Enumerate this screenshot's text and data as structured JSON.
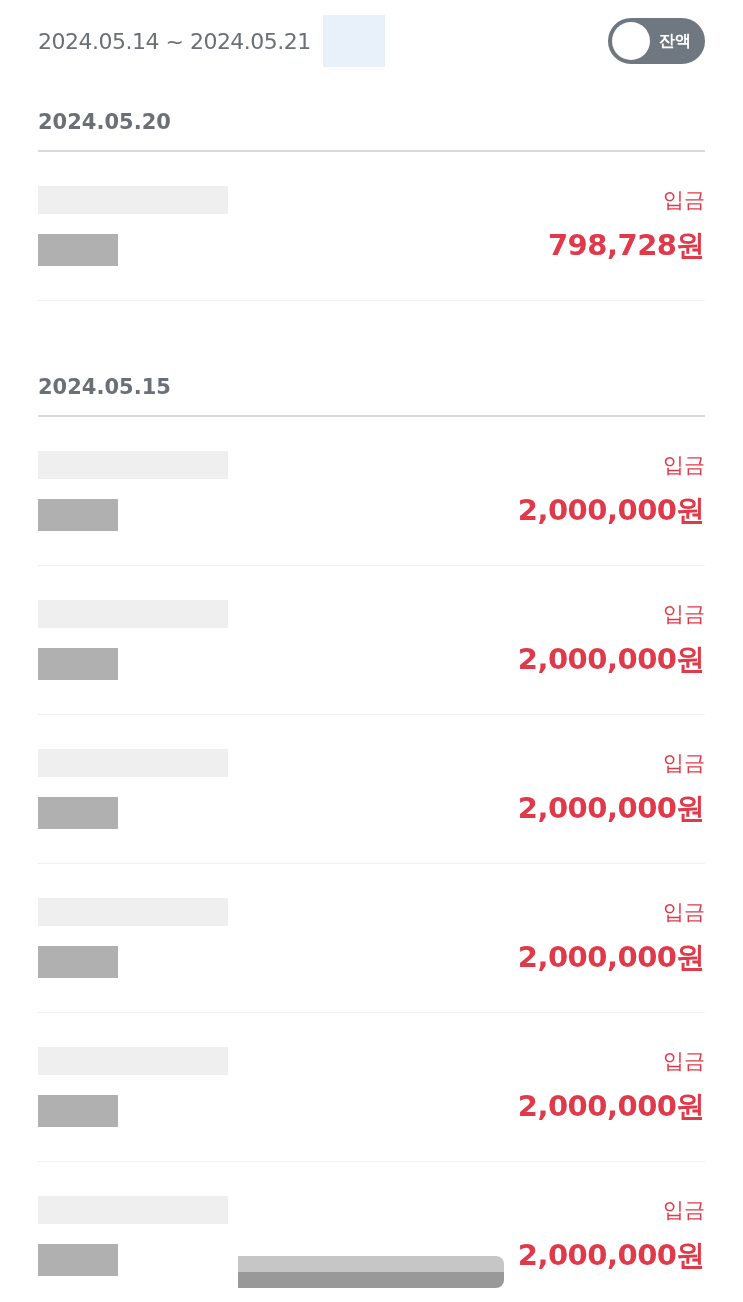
{
  "period": "2024.05.14 ~ 2024.05.21",
  "balance_toggle": {
    "label": "잔액",
    "on": false
  },
  "groups": [
    {
      "date": "2024.05.20",
      "transactions": [
        {
          "type": "입금",
          "amount": "798,728원"
        }
      ]
    },
    {
      "date": "2024.05.15",
      "transactions": [
        {
          "type": "입금",
          "amount": "2,000,000원"
        },
        {
          "type": "입금",
          "amount": "2,000,000원"
        },
        {
          "type": "입금",
          "amount": "2,000,000원"
        },
        {
          "type": "입금",
          "amount": "2,000,000원"
        },
        {
          "type": "입금",
          "amount": "2,000,000원"
        },
        {
          "type": "입금",
          "amount": "2,000,000원"
        }
      ]
    }
  ]
}
